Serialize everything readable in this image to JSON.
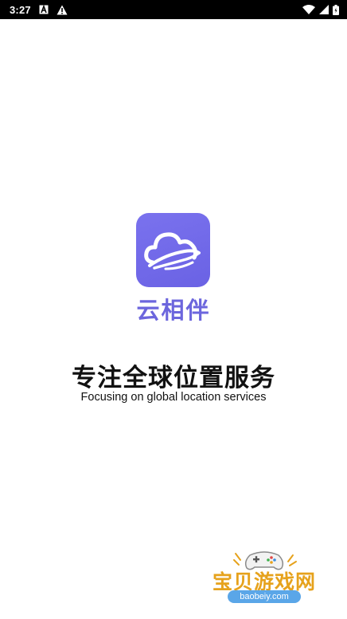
{
  "status_bar": {
    "time": "3:27",
    "left_icons": [
      "text-a-icon",
      "warning-icon"
    ],
    "right_icons": [
      "wifi-icon",
      "signal-icon",
      "battery-icon"
    ]
  },
  "app": {
    "name": "云相伴",
    "logo_icon": "cloud-logo-icon",
    "brand_color": "#6c66dd"
  },
  "slogan": {
    "chinese": "专注全球位置服务",
    "english": "Focusing on global location services"
  },
  "watermark": {
    "title": "宝贝游戏网",
    "url": "baobeiy.com"
  }
}
